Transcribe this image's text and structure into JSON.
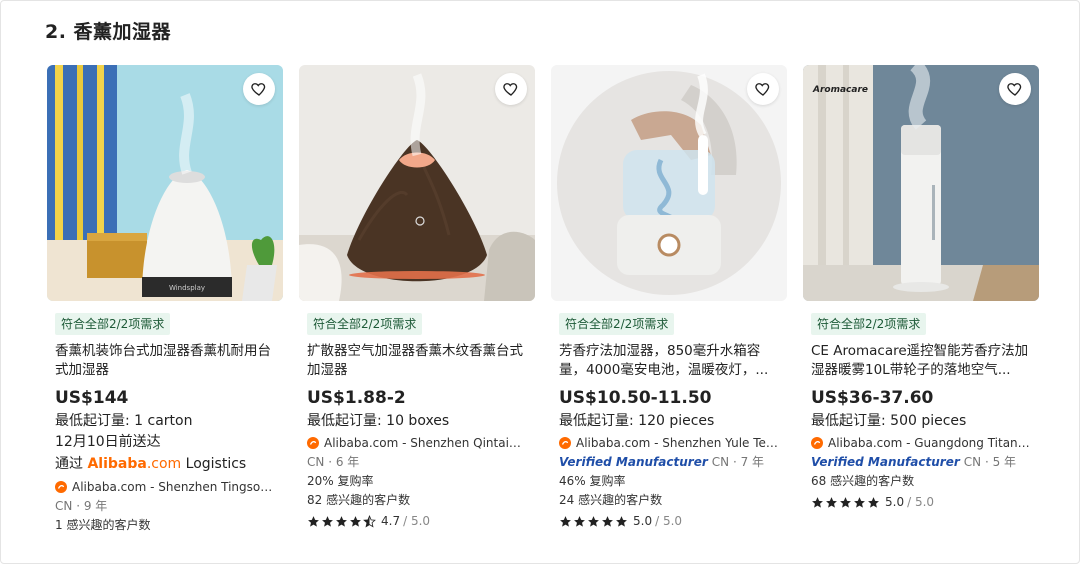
{
  "section": {
    "title": "2. 香薰加湿器"
  },
  "products": [
    {
      "badge": "符合全部2/2项需求",
      "title": "香薰机装饰台式加湿器香薰机耐用台式加湿器",
      "price": "US$144",
      "moq": "最低起订量: 1 carton",
      "delivery": "12月10日前送达",
      "logistics_prefix": "通过",
      "logistics_brand": "Alibaba",
      "logistics_com": ".com",
      "logistics_suffix": "Logistics",
      "supplier": "Alibaba.com - Shenzhen Tingson E...",
      "country": "CN",
      "years": "· 9 年",
      "stat1": "1 感兴趣的客户数",
      "img_label": "Windsplay"
    },
    {
      "badge": "符合全部2/2项需求",
      "title": "扩散器空气加湿器香薰木纹香薰台式加湿器",
      "price": "US$1.88-2",
      "moq": "最低起订量: 10 boxes",
      "supplier": "Alibaba.com - Shenzhen Qintaiyua...",
      "country": "CN",
      "years": "· 6 年",
      "stat1": "20% 复购率",
      "stat2": "82 感兴趣的客户数",
      "rating": "4.7",
      "rating_max": "/ 5.0"
    },
    {
      "badge": "符合全部2/2项需求",
      "title": "芳香疗法加湿器，850毫升水箱容量，4000毫安电池，温暖夜灯，...",
      "price": "US$10.50-11.50",
      "moq": "最低起订量: 120 pieces",
      "supplier": "Alibaba.com - Shenzhen Yule Tech...",
      "verified": "Verified Manufacturer",
      "country": "CN",
      "years": "· 7 年",
      "stat1": "46% 复购率",
      "stat2": "24 感兴趣的客户数",
      "rating": "5.0",
      "rating_max": "/ 5.0"
    },
    {
      "badge": "符合全部2/2项需求",
      "title": "CE Aromacare遥控智能芳香疗法加湿器暖雾10L带轮子的落地空气...",
      "price": "US$36-37.60",
      "moq": "最低起订量: 500 pieces",
      "supplier": "Alibaba.com - Guangdong Titan S...",
      "verified": "Verified Manufacturer",
      "country": "CN",
      "years": "· 5 年",
      "stat1": "68 感兴趣的客户数",
      "rating": "5.0",
      "rating_max": "/ 5.0",
      "img_label": "Aromacare"
    }
  ],
  "colors": {
    "accent": "#ff6a00",
    "badge_bg": "#e8f5ee",
    "badge_text": "#1d5a37",
    "verified": "#1f4ea8"
  }
}
